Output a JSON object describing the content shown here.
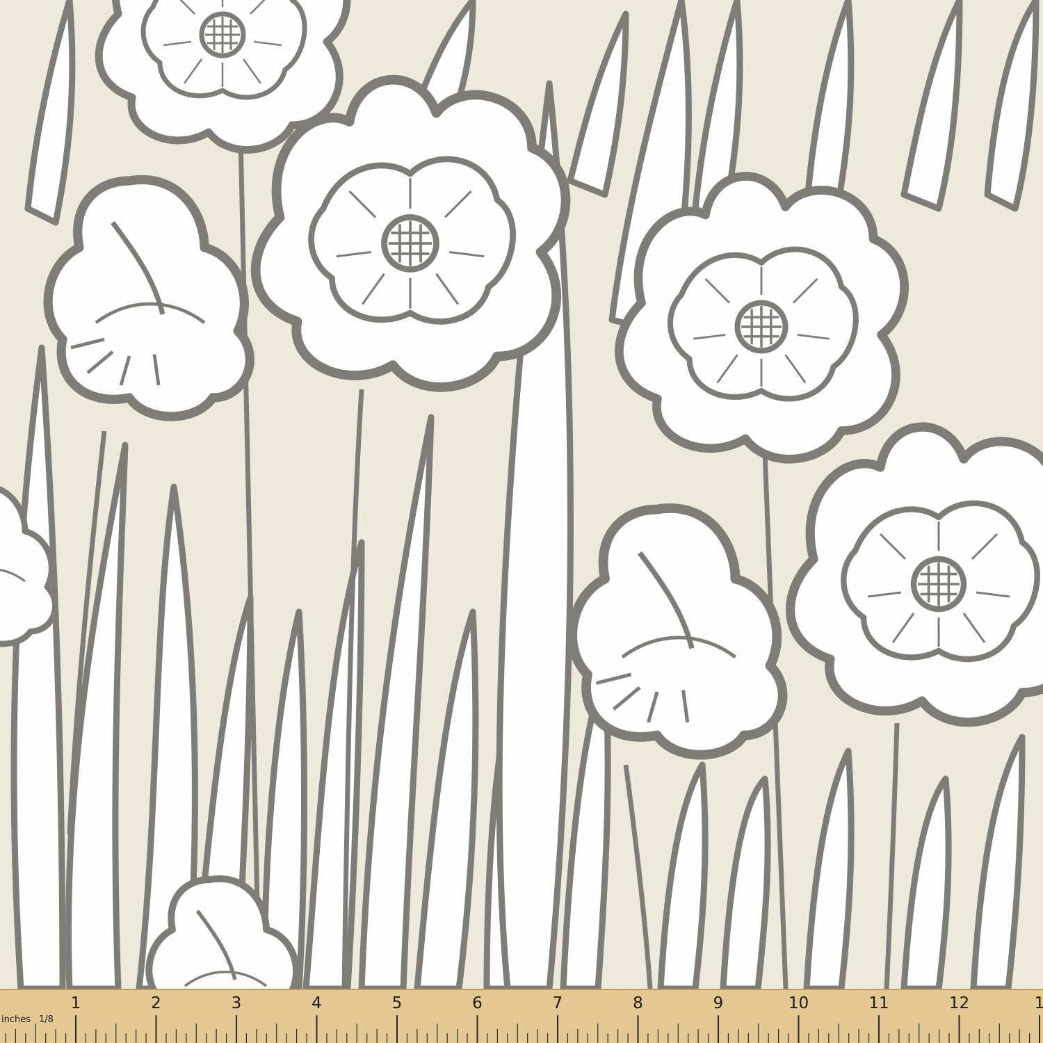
{
  "colors": {
    "background": "#eeeadc",
    "petal": "#ffffff",
    "outline": "#7f7d78",
    "ruler_wood": "#e3c893",
    "ruler_ink": "#1a1a1a"
  },
  "fabric": {
    "pattern": "poppy-and-grass-line-art"
  },
  "ruler": {
    "unit_label": "inches",
    "fraction_label": "1/8",
    "numbers": [
      "1",
      "2",
      "3",
      "4",
      "5",
      "6",
      "7",
      "8",
      "9",
      "10",
      "11",
      "12",
      "1"
    ]
  }
}
